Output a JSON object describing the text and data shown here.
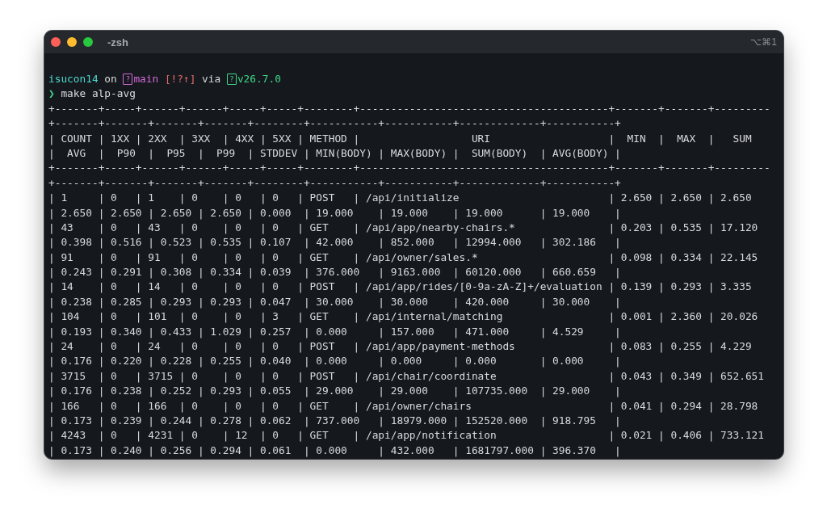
{
  "window": {
    "title": "-zsh",
    "shortcut": "⌥⌘1"
  },
  "prompt": {
    "directory": "isucon14",
    "on": "on",
    "branch_glyph": "?",
    "branch": "main",
    "git_status": "[!?↑]",
    "via": "via",
    "node_glyph": "?",
    "node_version": "v26.7.0"
  },
  "command": {
    "symbol": "❯",
    "text": "make alp-avg"
  },
  "output_lines": [
    "+-------+-----+------+------+-----+-----+--------+----------------------------------------+-------+-------+---------",
    "+-------+-------+-------+-------+--------+-----------+-----------+-------------+-----------+",
    "| COUNT | 1XX | 2XX  | 3XX  | 4XX | 5XX | METHOD |                  URI                   |  MIN  |  MAX  |   SUM",
    "|  AVG  |  P90  |  P95  |  P99  | STDDEV | MIN(BODY) | MAX(BODY) |  SUM(BODY)  | AVG(BODY) |",
    "+-------+-----+------+------+-----+-----+--------+----------------------------------------+-------+-------+---------",
    "+-------+-------+-------+-------+--------+-----------+-----------+-------------+-----------+",
    "| 1     | 0   | 1    | 0    | 0   | 0   | POST   | /api/initialize                        | 2.650 | 2.650 | 2.650",
    "| 2.650 | 2.650 | 2.650 | 2.650 | 0.000  | 19.000    | 19.000    | 19.000      | 19.000    |",
    "| 43    | 0   | 43   | 0    | 0   | 0   | GET    | /api/app/nearby-chairs.*               | 0.203 | 0.535 | 17.120",
    "| 0.398 | 0.516 | 0.523 | 0.535 | 0.107  | 42.000    | 852.000   | 12994.000   | 302.186   |",
    "| 91    | 0   | 91   | 0    | 0   | 0   | GET    | /api/owner/sales.*                     | 0.098 | 0.334 | 22.145",
    "| 0.243 | 0.291 | 0.308 | 0.334 | 0.039  | 376.000   | 9163.000  | 60120.000   | 660.659   |",
    "| 14    | 0   | 14   | 0    | 0   | 0   | POST   | /api/app/rides/[0-9a-zA-Z]+/evaluation | 0.139 | 0.293 | 3.335",
    "| 0.238 | 0.285 | 0.293 | 0.293 | 0.047  | 30.000    | 30.000    | 420.000     | 30.000    |",
    "| 104   | 0   | 101  | 0    | 0   | 3   | GET    | /api/internal/matching                 | 0.001 | 2.360 | 20.026",
    "| 0.193 | 0.340 | 0.433 | 1.029 | 0.257  | 0.000     | 157.000   | 471.000     | 4.529     |",
    "| 24    | 0   | 24   | 0    | 0   | 0   | POST   | /api/app/payment-methods               | 0.083 | 0.255 | 4.229",
    "| 0.176 | 0.220 | 0.228 | 0.255 | 0.040  | 0.000     | 0.000     | 0.000       | 0.000     |",
    "| 3715  | 0   | 3715 | 0    | 0   | 0   | POST   | /api/chair/coordinate                  | 0.043 | 0.349 | 652.651",
    "| 0.176 | 0.238 | 0.252 | 0.293 | 0.055  | 29.000    | 29.000    | 107735.000  | 29.000    |",
    "| 166   | 0   | 166  | 0    | 0   | 0   | GET    | /api/owner/chairs                      | 0.041 | 0.294 | 28.798",
    "| 0.173 | 0.239 | 0.244 | 0.278 | 0.062  | 737.000   | 18979.000 | 152520.000  | 918.795   |",
    "| 4243  | 0   | 4231 | 0    | 12  | 0   | GET    | /api/app/notification                  | 0.021 | 0.406 | 733.121",
    "| 0.173 | 0.240 | 0.256 | 0.294 | 0.061  | 0.000     | 432.000   | 1681797.000 | 396.370   |"
  ]
}
